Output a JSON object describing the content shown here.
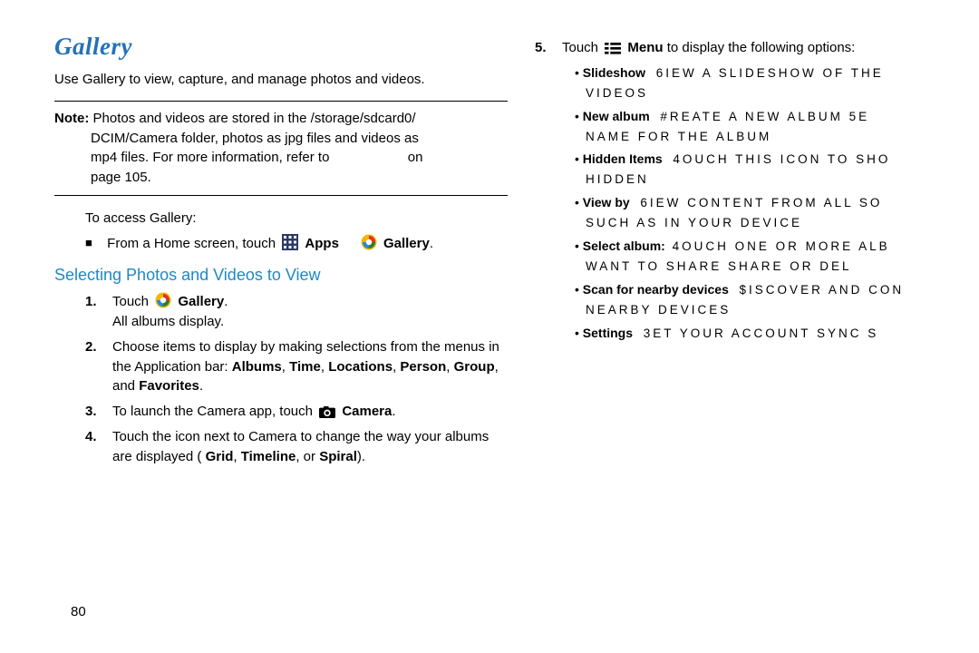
{
  "page_number": "80",
  "left": {
    "title": "Gallery",
    "intro": "Use Gallery to view, capture, and manage photos and videos.",
    "note": {
      "label": "Note:",
      "text_line1": "Photos and videos are stored in the /storage/sdcard0/",
      "text_line2": "DCIM/Camera folder, photos as jpg files and videos as",
      "text_line3": "mp4 files. For more information, refer to",
      "text_line4_on": "on",
      "text_line5": "page 105."
    },
    "access_label": "To access Gallery:",
    "from_home_a": "From a Home screen, touch ",
    "apps_label": "Apps",
    "gallery_label": "Gallery",
    "period": ".",
    "subheading": "Selecting Photos and Videos to View",
    "steps": {
      "1a": "Touch ",
      "1b": "All albums display.",
      "2a": "Choose items to display by making selections from the menus in the Application bar: ",
      "2b": "Albums",
      "2c": "Time",
      "2d": "Locations",
      "2e": "Person",
      "2f": "Group",
      "2g": "Favorites",
      "3a": "To launch the Camera app, touch ",
      "3b": "Camera",
      "4": "Touch the icon next to Camera to change the way your albums are displayed (",
      "4b": "Grid",
      "4c": "Timeline",
      "4d": "Spiral",
      "4e": ")."
    }
  },
  "right": {
    "step5_a": "Touch ",
    "menu_label": "Menu",
    "step5_b": " to display the following options:",
    "items": {
      "slideshow": {
        "label": "Slideshow",
        "text1": "6IEW A SLIDESHOW OF THE",
        "text2": "VIDEOS"
      },
      "new_album": {
        "label": "New album",
        "text1": "#REATE A NEW ALBUM  5E",
        "text2": "NAME FOR THE ALBUM"
      },
      "hidden": {
        "label": "Hidden Items",
        "text1": "4OUCH THIS ICON TO SHO",
        "text2": "HIDDEN"
      },
      "view_by": {
        "label": "View by",
        "text1": "6IEW CONTENT FROM ALL SO",
        "text2": "SUCH AS IN YOUR DEVICE"
      },
      "select": {
        "label": "Select album:",
        "text1": "4OUCH ONE OR MORE ALB",
        "text2": "WANT TO SHARE  SHARE  OR DEL"
      },
      "scan": {
        "label": "Scan for nearby devices",
        "text1": "$ISCOVER AND CON",
        "text2": "NEARBY DEVICES"
      },
      "settings": {
        "label": "Settings",
        "text1": "3ET YOUR ACCOUNT SYNC S"
      }
    }
  }
}
